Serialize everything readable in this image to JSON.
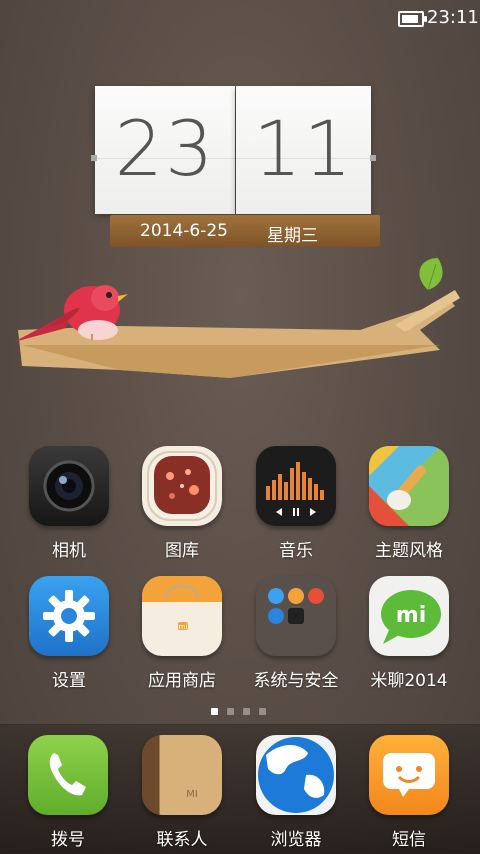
{
  "status_bar": {
    "time": "23:11",
    "battery_icon": "battery-icon",
    "battery_level": 0.85
  },
  "clock_widget": {
    "hour": "23",
    "minute": "11",
    "date": "2014-6-25",
    "weekday": "星期三"
  },
  "apps": [
    {
      "id": "camera",
      "label": "相机",
      "icon": "camera-icon"
    },
    {
      "id": "gallery",
      "label": "图库",
      "icon": "gallery-icon"
    },
    {
      "id": "music",
      "label": "音乐",
      "icon": "music-icon"
    },
    {
      "id": "themes",
      "label": "主题风格",
      "icon": "theme-brush-icon"
    },
    {
      "id": "settings",
      "label": "设置",
      "icon": "gear-icon"
    },
    {
      "id": "app-store",
      "label": "应用商店",
      "icon": "shopping-bag-icon"
    },
    {
      "id": "system-security",
      "label": "系统与安全",
      "icon": "folder-icon"
    },
    {
      "id": "miliao",
      "label": "米聊2014",
      "icon": "mi-chat-icon"
    }
  ],
  "page_indicator": {
    "count": 4,
    "active": 1
  },
  "dock": [
    {
      "id": "dialer",
      "label": "拨号",
      "icon": "phone-icon"
    },
    {
      "id": "contacts",
      "label": "联系人",
      "icon": "contacts-book-icon"
    },
    {
      "id": "browser",
      "label": "浏览器",
      "icon": "globe-icon"
    },
    {
      "id": "messages",
      "label": "短信",
      "icon": "message-icon"
    }
  ],
  "folder_badge": "mi"
}
